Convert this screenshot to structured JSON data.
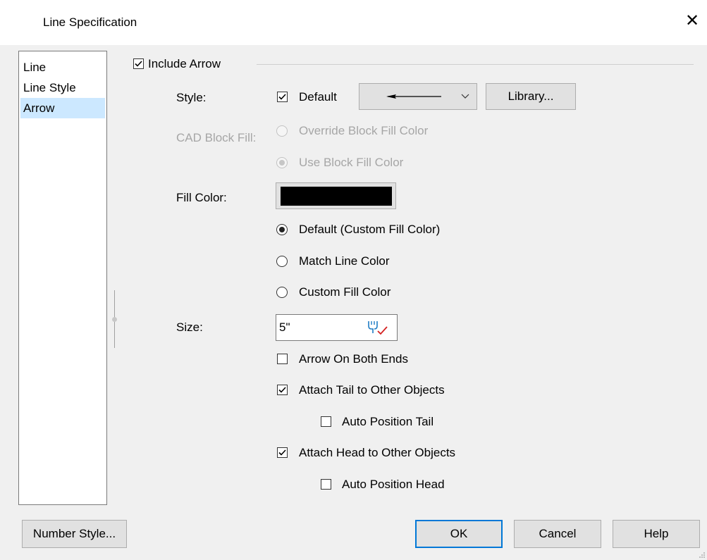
{
  "window": {
    "title": "Line Specification",
    "close_glyph": "✕"
  },
  "sidebar": {
    "items": [
      {
        "label": "Line",
        "selected": false
      },
      {
        "label": "Line Style",
        "selected": false
      },
      {
        "label": "Arrow",
        "selected": true
      }
    ]
  },
  "arrow_panel": {
    "include_arrow": {
      "label": "Include Arrow",
      "checked": true
    },
    "style": {
      "label": "Style:",
      "default_checkbox": {
        "label": "Default",
        "checked": true
      },
      "dropdown_icon": "arrow-left-line-icon",
      "library_button": "Library..."
    },
    "cad_block_fill": {
      "label": "CAD Block Fill:",
      "options": [
        {
          "label": "Override Block Fill Color",
          "selected": false,
          "disabled": true
        },
        {
          "label": "Use Block Fill Color",
          "selected": true,
          "disabled": true
        }
      ]
    },
    "fill_color": {
      "label": "Fill Color:",
      "swatch_color": "#000000",
      "options": [
        {
          "label": "Default (Custom Fill Color)",
          "selected": true
        },
        {
          "label": "Match Line Color",
          "selected": false
        },
        {
          "label": "Custom Fill Color",
          "selected": false
        }
      ]
    },
    "size": {
      "label": "Size:",
      "value": "5\""
    },
    "checkboxes": [
      {
        "label": "Arrow On Both Ends",
        "checked": false
      },
      {
        "label": "Attach Tail to Other Objects",
        "checked": true
      },
      {
        "label": "Auto Position Tail",
        "checked": false
      },
      {
        "label": "Attach Head to Other Objects",
        "checked": true
      },
      {
        "label": "Auto Position Head",
        "checked": false
      }
    ]
  },
  "footer": {
    "number_style_button": "Number Style...",
    "ok_button": "OK",
    "cancel_button": "Cancel",
    "help_button": "Help"
  },
  "colors": {
    "accent": "#0078d7",
    "selection": "#cce8ff"
  }
}
